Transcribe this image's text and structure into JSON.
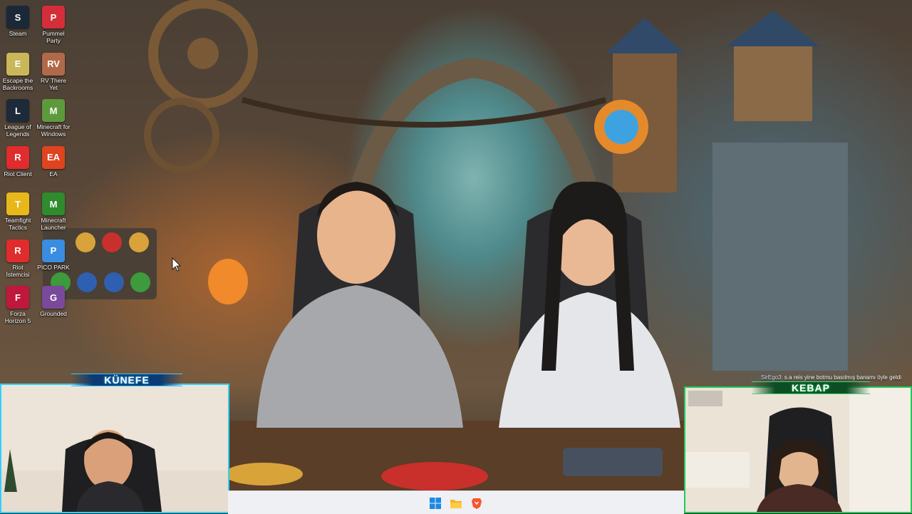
{
  "desktop": {
    "icons": [
      {
        "label": "Steam",
        "icon": "steam-icon",
        "color": "#1b2838"
      },
      {
        "label": "Pummel Party",
        "icon": "pummel-party-icon",
        "color": "#d42e3a"
      },
      {
        "label": "Escape the Backrooms",
        "icon": "escape-backrooms-icon",
        "color": "#c9b75a"
      },
      {
        "label": "RV There Yet",
        "icon": "rv-there-yet-icon",
        "color": "#b06a4a"
      },
      {
        "label": "League of Legends",
        "icon": "league-of-legends-icon",
        "color": "#1c2a3a"
      },
      {
        "label": "Minecraft for Windows",
        "icon": "minecraft-icon",
        "color": "#5d9a3b"
      },
      {
        "label": "Riot Client",
        "icon": "riot-client-icon",
        "color": "#e02c2c"
      },
      {
        "label": "EA",
        "icon": "ea-icon",
        "color": "#e0431f"
      },
      {
        "label": "Teamfight Tactics",
        "icon": "teamfight-tactics-icon",
        "color": "#e8b81a"
      },
      {
        "label": "Minecraft Launcher",
        "icon": "minecraft-launcher-icon",
        "color": "#2e8b2e"
      },
      {
        "label": "Riot İstemcisi",
        "icon": "riot-client-icon",
        "color": "#e02c2c"
      },
      {
        "label": "PICO PARK",
        "icon": "pico-park-icon",
        "color": "#3a8de0"
      },
      {
        "label": "Forza Horizon 5",
        "icon": "forza-horizon-icon",
        "color": "#c0183d"
      },
      {
        "label": "Grounded",
        "icon": "grounded-icon",
        "color": "#7a4a9a"
      }
    ]
  },
  "overlay": {
    "left_cam_label": "KÜNEFE",
    "right_cam_label": "KEBAP",
    "chat": {
      "user": "SirEgo3:",
      "message": "s.a reis yine botmu basılmış banamı öyle geldi"
    },
    "accent_left": "#2fd0ff",
    "accent_right": "#22c95a"
  },
  "taskbar": {
    "items": [
      {
        "icon": "windows-start-icon",
        "color": "#1e88e5"
      },
      {
        "icon": "file-explorer-icon",
        "color": "#f5b324"
      },
      {
        "icon": "brave-browser-icon",
        "color": "#fb542b"
      }
    ]
  }
}
